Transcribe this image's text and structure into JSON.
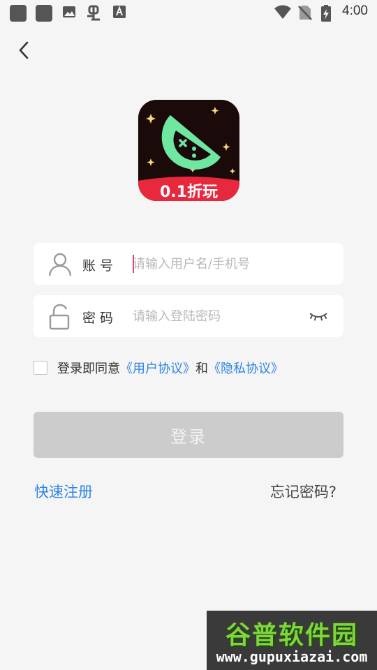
{
  "status_bar": {
    "time": "4:00",
    "notification_icons": [
      "app-icon",
      "app-icon",
      "image-icon",
      "bug-icon",
      "font-icon"
    ],
    "system_icons": [
      "wifi-icon",
      "no-sim-icon",
      "battery-charging-icon"
    ]
  },
  "logo": {
    "text": "0.1折玩",
    "colors": {
      "background": "#1a0a0a",
      "banner": "#e8283c",
      "accent": "#6ee7a1"
    }
  },
  "account_field": {
    "label": "账号",
    "placeholder": "请输入用户名/手机号",
    "value": ""
  },
  "password_field": {
    "label": "密码",
    "placeholder": "请输入登陆密码",
    "value": ""
  },
  "agreement": {
    "checked": false,
    "prefix": "登录即同意",
    "user_agreement": "《用户协议》",
    "conjunction": "和",
    "privacy_policy": "《隐私协议》"
  },
  "login_button": {
    "label": "登录"
  },
  "register_link": "快速注册",
  "forgot_password": "忘记密码?",
  "watermark": {
    "title": "谷普软件园",
    "url": "www.gupuxiazai.com"
  },
  "colors": {
    "link": "#2f84e6",
    "caret": "#e0457a",
    "button_disabled": "#cccccc",
    "background": "#f5f5f5"
  }
}
